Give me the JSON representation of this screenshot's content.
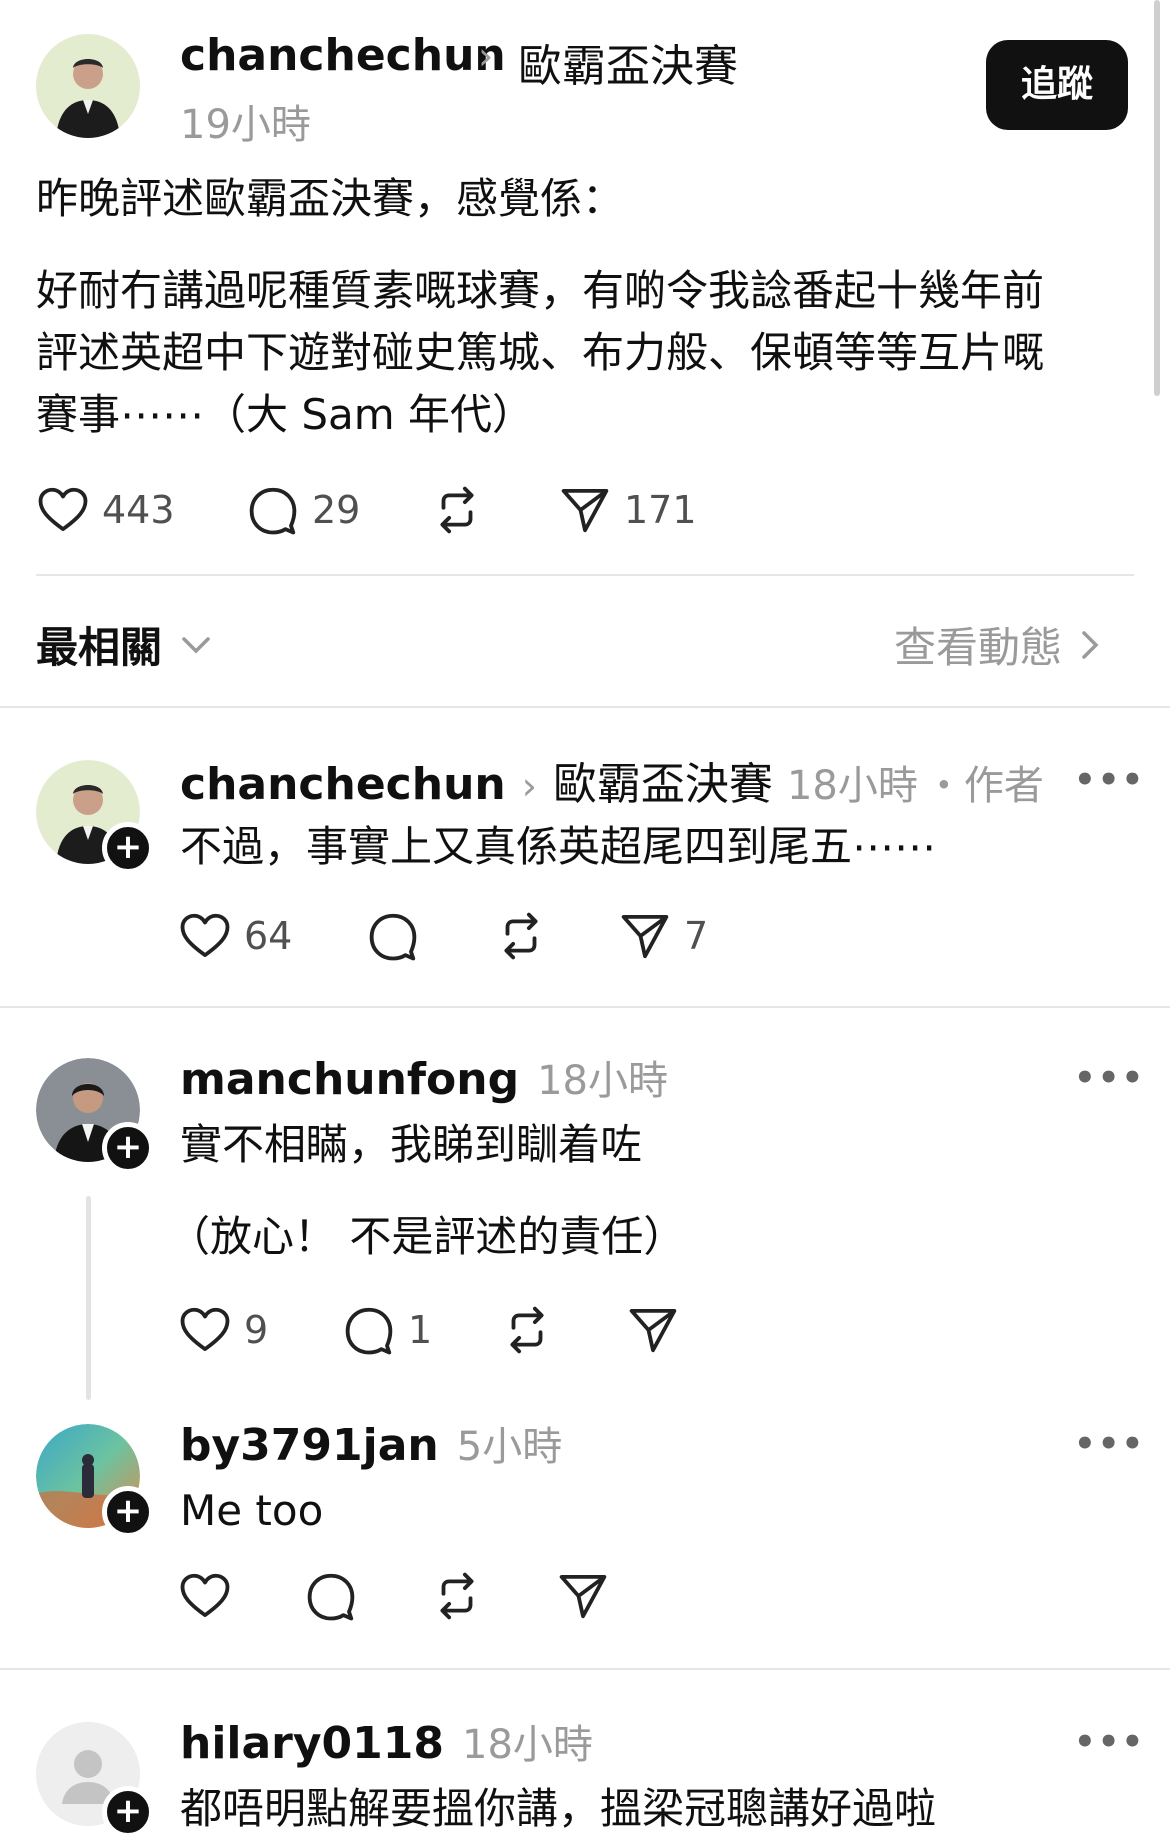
{
  "post": {
    "username": "chanchechun",
    "topic": "歐霸盃決賽",
    "time": "19小時",
    "follow_label": "追蹤",
    "line1": "昨晚評述歐霸盃決賽，感覺係：",
    "paragraph": [
      "好耐冇講過呢種質素嘅球賽，有啲令我諗番起十幾年前",
      "評述英超中下遊對碰史篤城、布力般、保頓等等互片嘅",
      "賽事⋯⋯（大 Sam 年代）"
    ],
    "likes": "443",
    "replies": "29",
    "shares": "171"
  },
  "sort": {
    "label": "最相關",
    "activity_link": "查看動態"
  },
  "comments": [
    {
      "username": "chanchechun",
      "topic": "歐霸盃決賽",
      "time": "18小時",
      "tag": "・作者",
      "text": "不過，事實上又真係英超尾四到尾五⋯⋯",
      "likes": "64",
      "shares": "7"
    },
    {
      "username": "manchunfong",
      "time": "18小時",
      "text": "實不相瞞，我睇到瞓着咗",
      "text2": "（放心！ 不是評述的責任）",
      "likes": "9",
      "replies": "1"
    },
    {
      "username": "by3791jan",
      "time": "5小時",
      "text": "Me too"
    },
    {
      "username": "hilary0118",
      "time": "18小時",
      "text": "都唔明點解要搵你講，搵梁冠聰講好過啦"
    }
  ],
  "icons": [
    "heart-icon",
    "comment-icon",
    "repost-icon",
    "send-icon",
    "more-icon",
    "chevron-right-icon",
    "chevron-down-icon",
    "plus-icon"
  ],
  "colors": {
    "text": "#101010",
    "muted": "#9a9a9a",
    "button_bg": "#111111",
    "divider": "#e6e6e6"
  }
}
